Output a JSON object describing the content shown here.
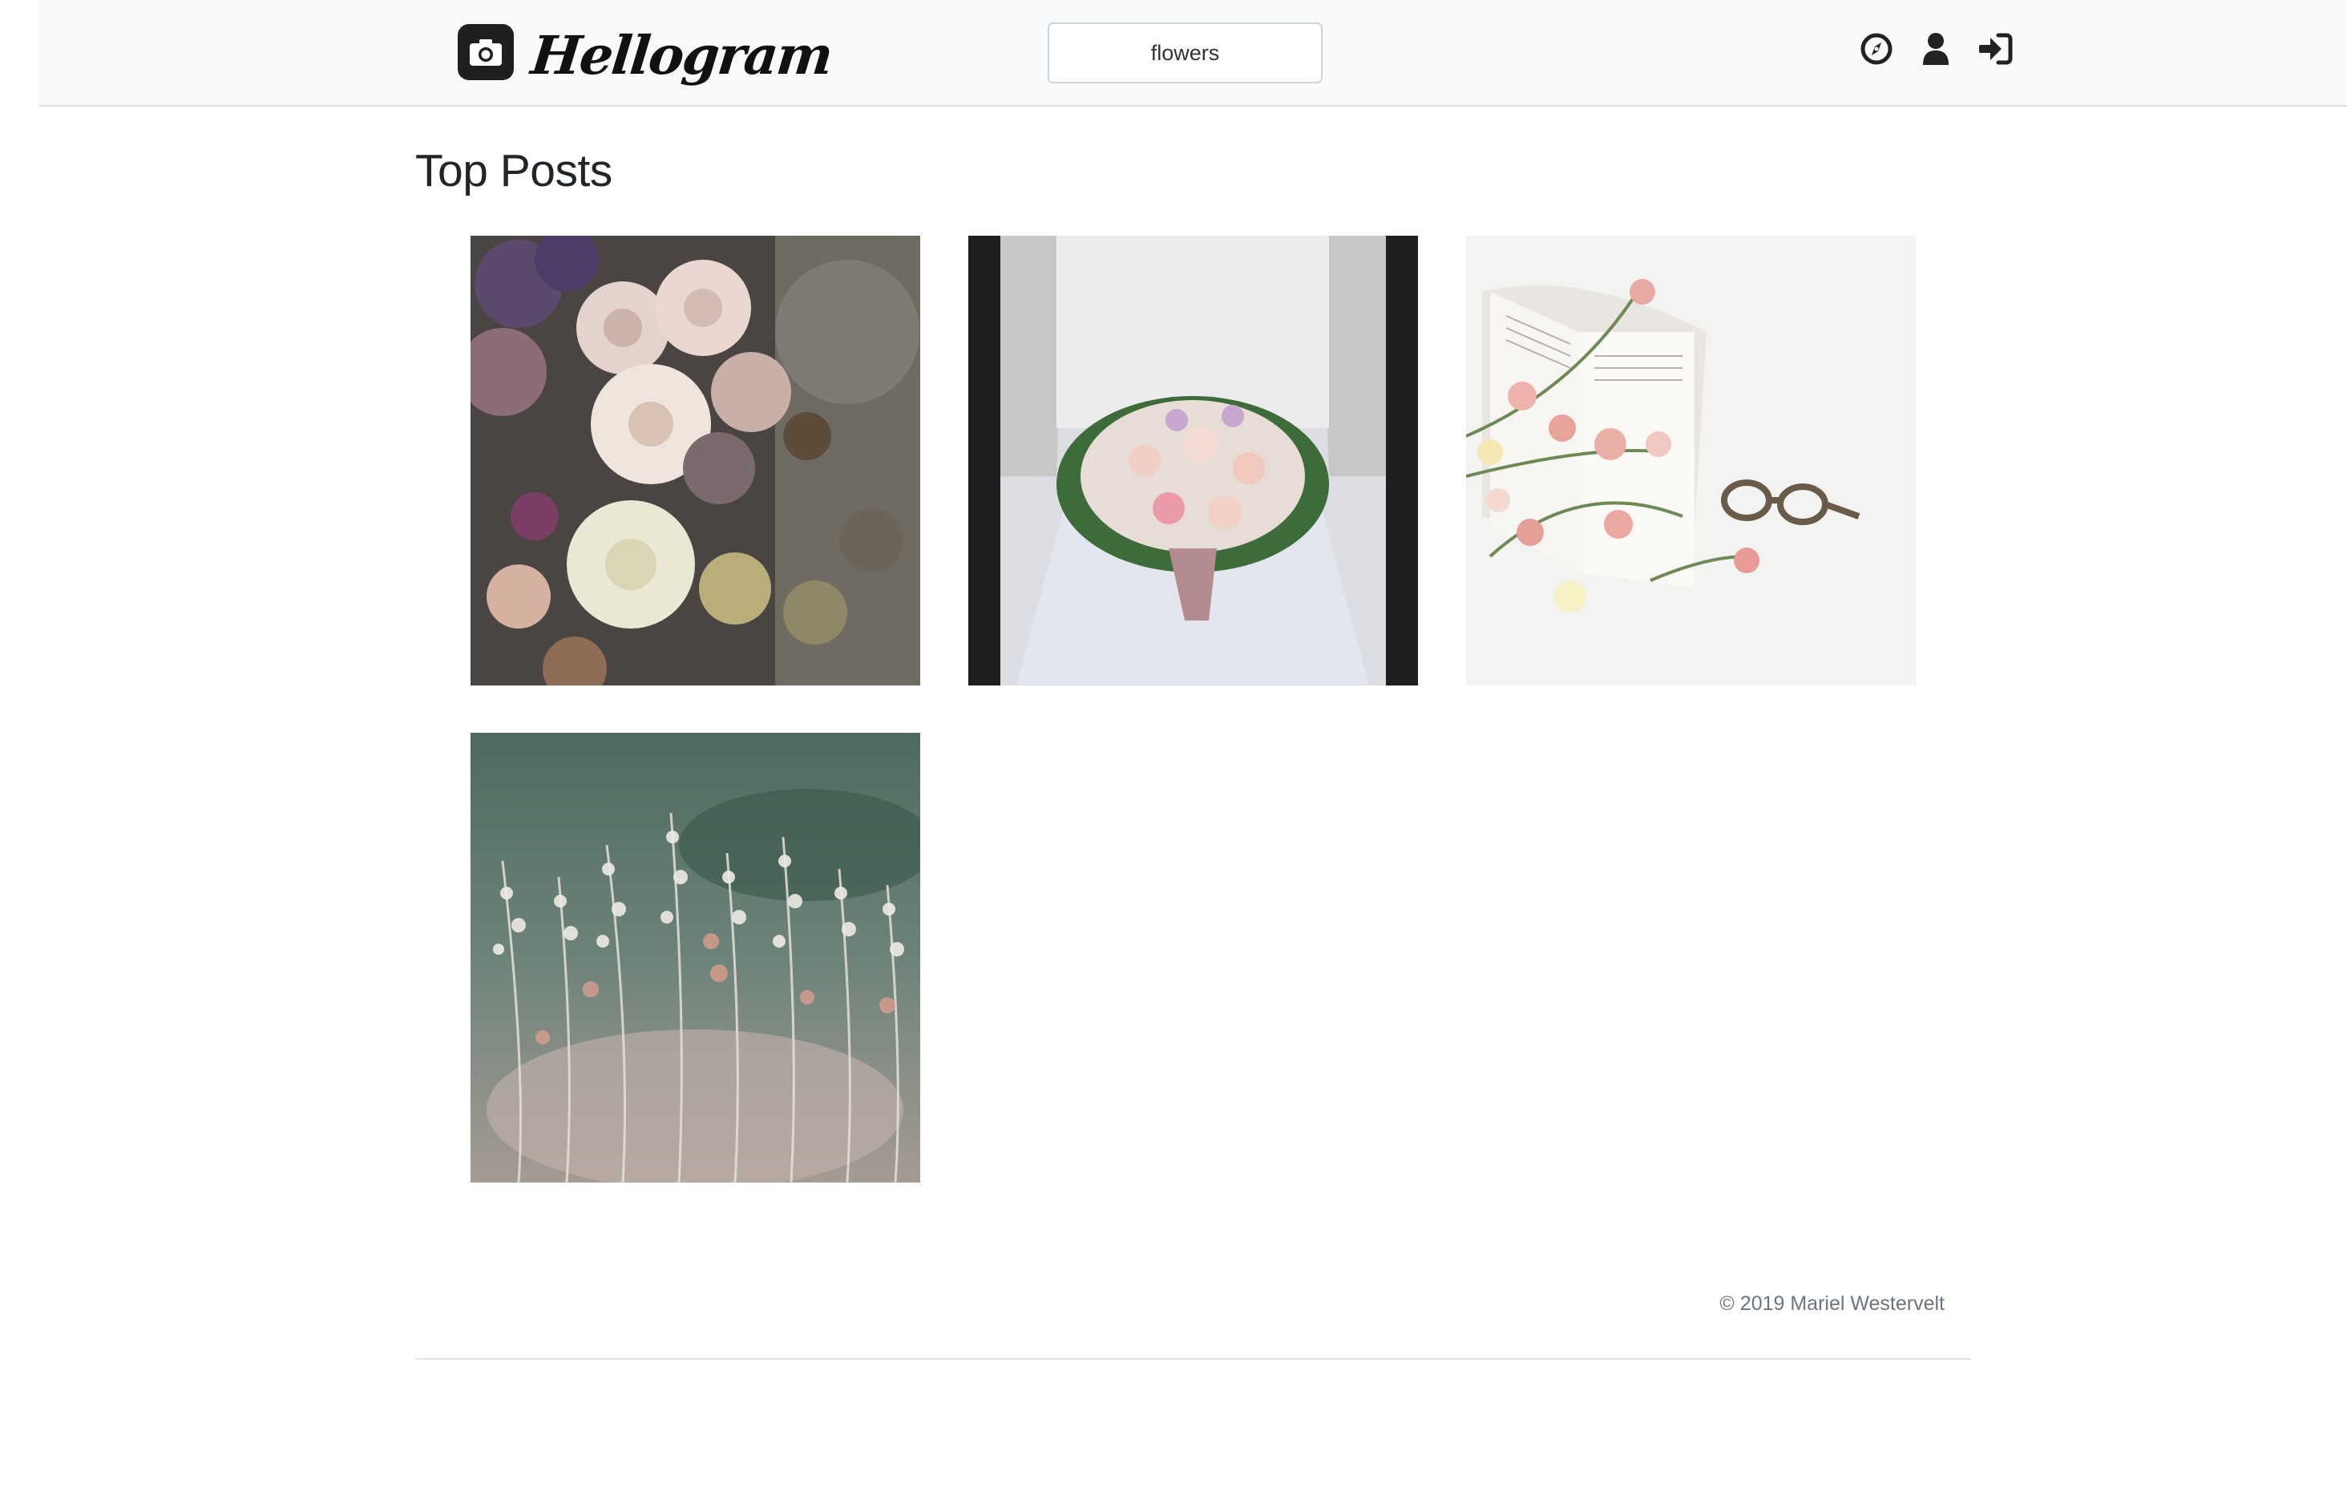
{
  "header": {
    "brand_name": "Hellogram",
    "brand_icon": "camera-icon",
    "search": {
      "value": "flowers",
      "placeholder": ""
    },
    "nav": [
      {
        "icon": "compass-icon"
      },
      {
        "icon": "user-icon"
      },
      {
        "icon": "sign-in-icon"
      }
    ]
  },
  "main": {
    "title": "Top Posts",
    "posts": [
      {
        "subject": "rose-bouquet"
      },
      {
        "subject": "bridal-bouquet"
      },
      {
        "subject": "flowers-book-glasses"
      },
      {
        "subject": "wild-grass"
      }
    ]
  },
  "footer": {
    "copyright": "© 2019 Mariel Westervelt"
  },
  "colors": {
    "header_bg": "#f8f9fa",
    "text": "#212529",
    "muted": "#6c757d"
  }
}
